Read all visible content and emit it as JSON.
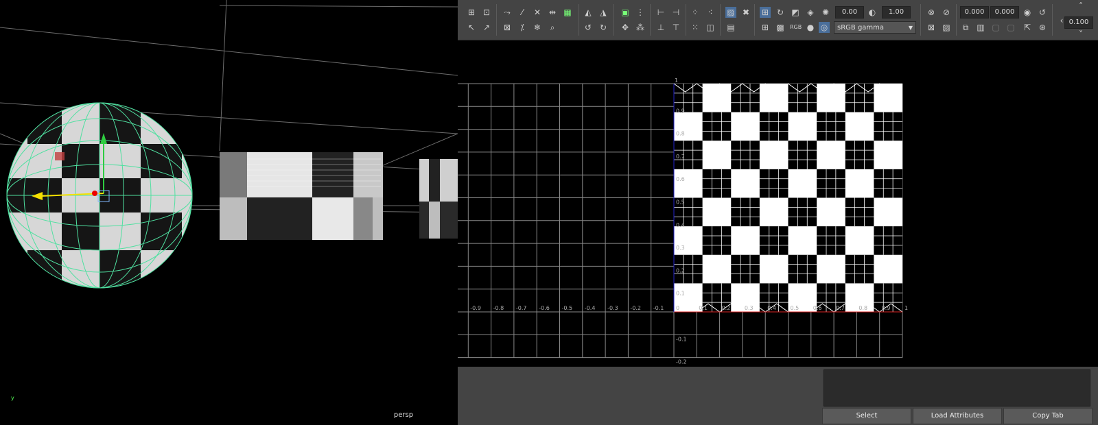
{
  "perspective_view": {
    "camera_label": "persp",
    "axis_y": "y"
  },
  "uv_toolbar": {
    "rotate_value": "0.00",
    "scale_value": "1.00",
    "color_space": "sRGB gamma",
    "rgb_label": "RGB",
    "offset_u": "0.000",
    "offset_v": "0.000",
    "step_value": "0.100"
  },
  "uv_grid": {
    "top_label": "1",
    "x_labels": [
      "-0.9",
      "-0.8",
      "-0.7",
      "-0.6",
      "-0.5",
      "-0.4",
      "-0.3",
      "-0.2",
      "-0.1",
      "0",
      "0.1",
      "0.2",
      "0.3",
      "0.4",
      "0.5",
      "0.6",
      "0.7",
      "0.8",
      "0.9",
      "1"
    ],
    "y_labels": [
      "0.9",
      "0.8",
      "0.7",
      "0.6",
      "0.5",
      "0.4",
      "0.3",
      "0.2",
      "0.1",
      "-0.1",
      "-0.2"
    ]
  },
  "attribute_editor": {
    "select_label": "Select",
    "load_label": "Load Attributes",
    "copy_label": "Copy Tab"
  }
}
